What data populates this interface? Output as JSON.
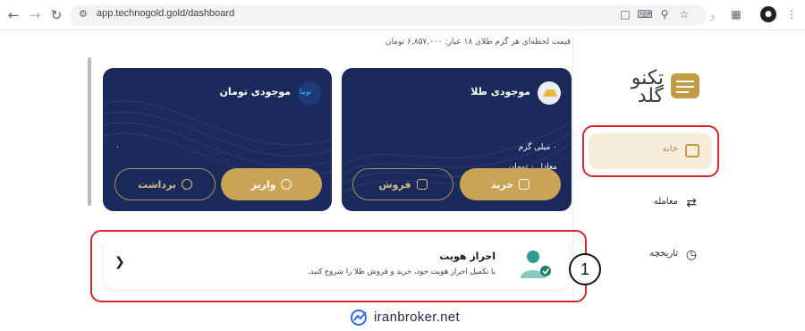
{
  "browser": {
    "url": "app.technogold.gold/dashboard"
  },
  "header": {
    "price_text": "قیمت لحظه‌ای هر گرم طلای ۱۸ عیار: ۶,۸۵۷,۰۰۰ تومان"
  },
  "gold_wallet": {
    "title": "موجودی طلا",
    "amount": "۰ میلی گرم",
    "equivalent": "معادل ۰ تومان",
    "buy_label": "خرید",
    "sell_label": "فروش"
  },
  "toman_wallet": {
    "title": "موجودی تومان",
    "icon_text": "توما",
    "amount": "۰",
    "deposit_label": "واریز",
    "withdraw_label": "برداشت"
  },
  "verify": {
    "title": "احراز هویت",
    "description": "با تکمیل احراز هویت خود، خرید و فروش طلا را شروع کنید.",
    "step_number": "1"
  },
  "sidebar": {
    "logo_text": "تکنو گلد",
    "items": [
      {
        "label": "خانه",
        "active": true
      },
      {
        "label": "معامله",
        "active": false
      },
      {
        "label": "تاریخچه",
        "active": false
      }
    ]
  },
  "watermark": {
    "text": "iranbroker.net"
  },
  "colors": {
    "card_navy": "#1b2a5a",
    "gold": "#caa355",
    "highlight_red": "#d6262e",
    "nav_active_bg": "#f5ecda"
  }
}
